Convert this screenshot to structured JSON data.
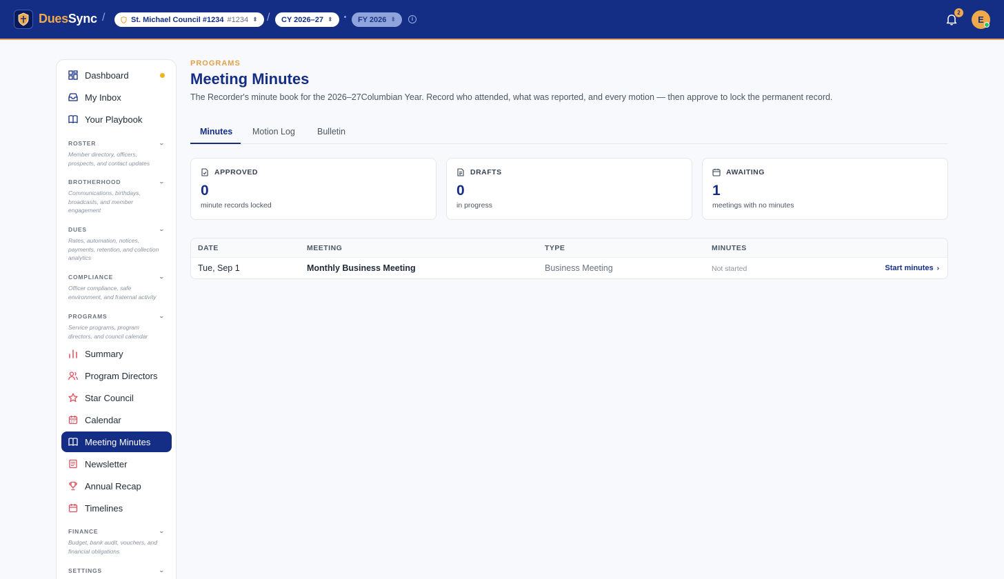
{
  "app": {
    "brand_part1": "Dues",
    "brand_part2": "Sync",
    "council": "St. Michael Council #1234",
    "council_number": "#1234",
    "cy": "CY 2026–27",
    "fy": "FY 2026",
    "notification_count": "2",
    "avatar_initial": "E"
  },
  "sidebar": {
    "top": [
      {
        "label": "Dashboard",
        "icon": "dashboard-icon"
      },
      {
        "label": "My Inbox",
        "icon": "inbox-icon"
      },
      {
        "label": "Your Playbook",
        "icon": "book-icon"
      }
    ],
    "sections": [
      {
        "title": "ROSTER",
        "desc": "Member directory, officers, prospects, and contact updates"
      },
      {
        "title": "BROTHERHOOD",
        "desc": "Communications, birthdays, broadcasts, and member engagement"
      },
      {
        "title": "DUES",
        "desc": "Rates, automation, notices, payments, retention, and collection analytics"
      },
      {
        "title": "COMPLIANCE",
        "desc": "Officer compliance, safe environment, and fraternal activity"
      },
      {
        "title": "PROGRAMS",
        "desc": "Service programs, program directors, and council calendar"
      },
      {
        "title": "FINANCE",
        "desc": "Budget, bank audit, vouchers, and financial obligations"
      },
      {
        "title": "SETTINGS",
        "desc": ""
      }
    ],
    "programs": [
      {
        "label": "Summary",
        "icon": "bar-chart-icon"
      },
      {
        "label": "Program Directors",
        "icon": "users-icon"
      },
      {
        "label": "Star Council",
        "icon": "star-icon"
      },
      {
        "label": "Calendar",
        "icon": "calendar-icon"
      },
      {
        "label": "Meeting Minutes",
        "icon": "book-open-icon"
      },
      {
        "label": "Newsletter",
        "icon": "newspaper-icon"
      },
      {
        "label": "Annual Recap",
        "icon": "trophy-icon"
      },
      {
        "label": "Timelines",
        "icon": "calendar-range-icon"
      }
    ]
  },
  "page": {
    "eyebrow": "PROGRAMS",
    "title": "Meeting Minutes",
    "subtitle": "The Recorder's minute book for the 2026–27Columbian Year. Record who attended, what was reported, and every motion — then approve to lock the permanent record.",
    "tabs": [
      "Minutes",
      "Motion Log",
      "Bulletin"
    ]
  },
  "stats": [
    {
      "label": "APPROVED",
      "value": "0",
      "caption": "minute records locked"
    },
    {
      "label": "DRAFTS",
      "value": "0",
      "caption": "in progress"
    },
    {
      "label": "AWAITING",
      "value": "1",
      "caption": "meetings with no minutes"
    }
  ],
  "table": {
    "headers": [
      "DATE",
      "MEETING",
      "TYPE",
      "MINUTES"
    ],
    "rows": [
      {
        "date": "Tue, Sep 1",
        "meeting": "Monthly Business Meeting",
        "type": "Business Meeting",
        "minutes": "Not started",
        "action": "Start minutes"
      }
    ]
  },
  "colors": {
    "primary": "#142d85",
    "accent": "#f0a94a",
    "program_icon": "#e04e5c"
  }
}
